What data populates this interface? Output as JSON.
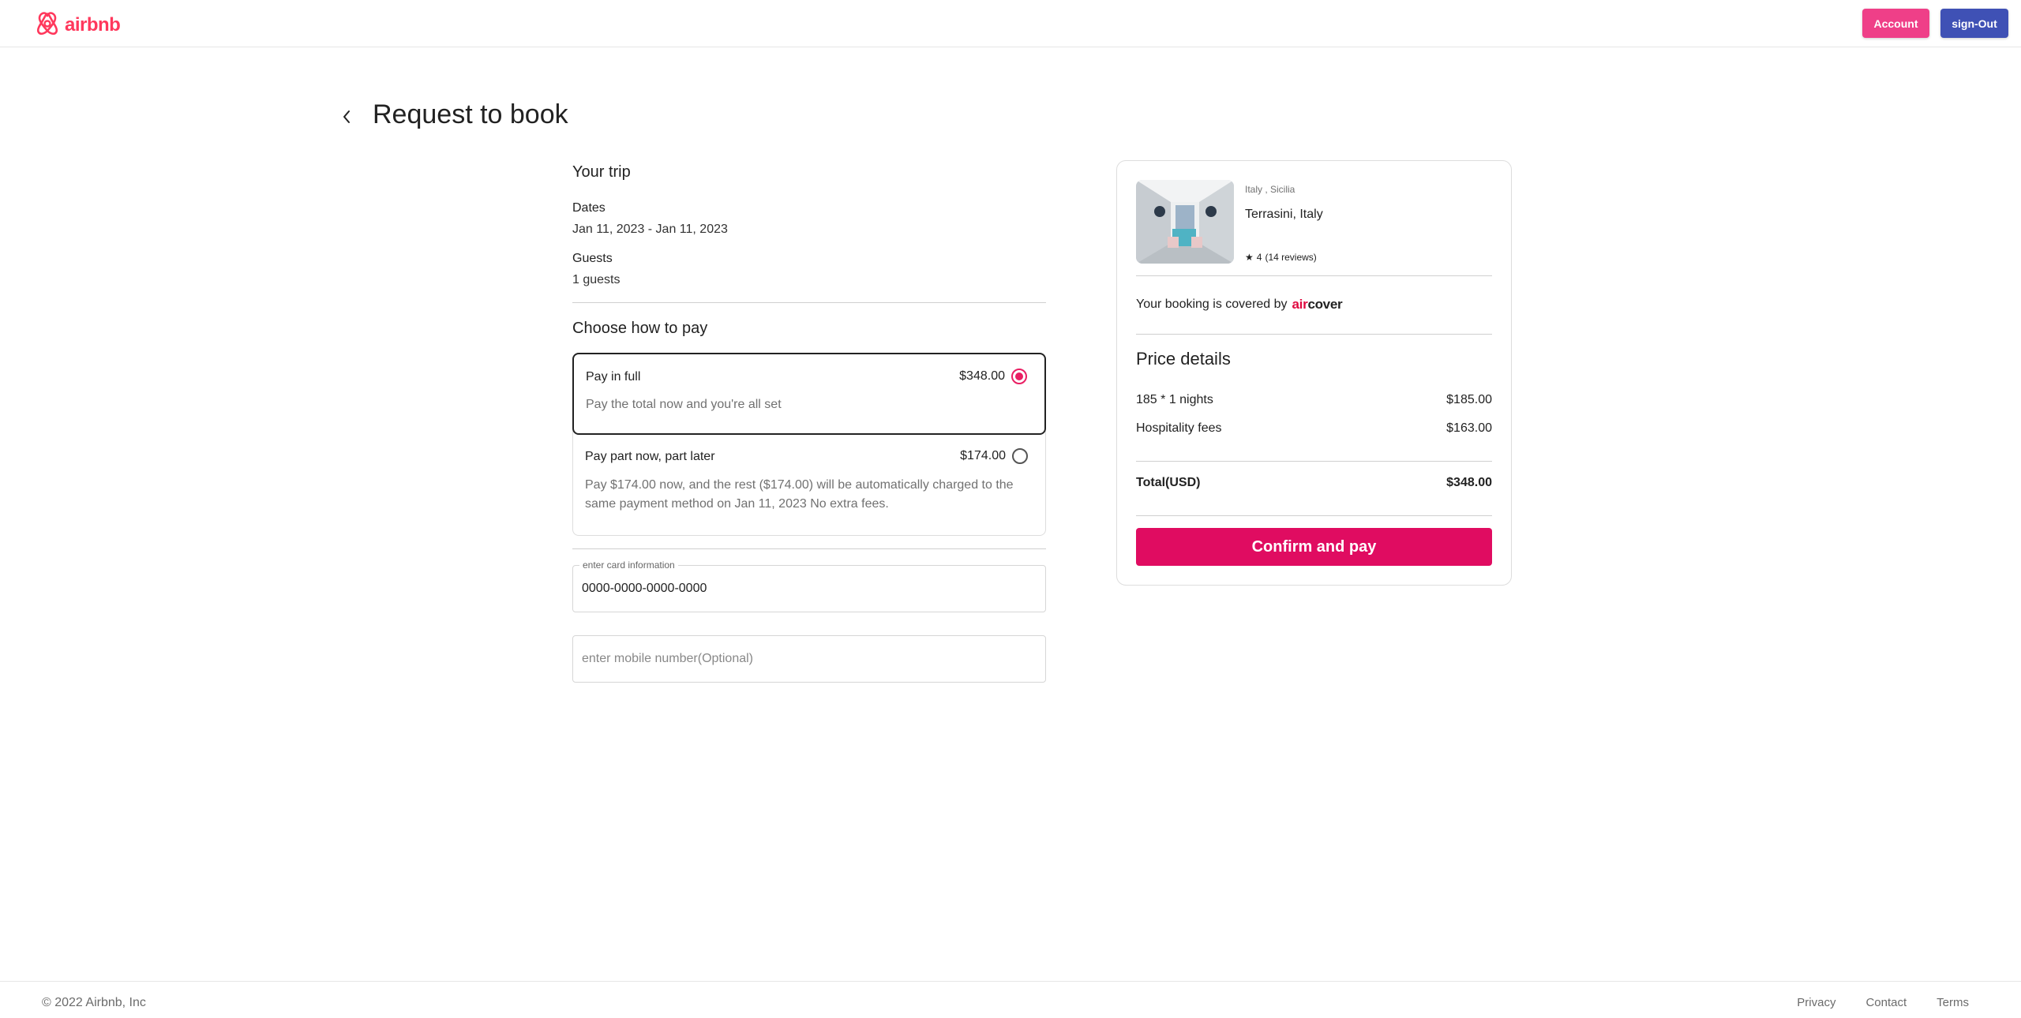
{
  "header": {
    "brand": "airbnb",
    "account_label": "Account",
    "signout_label": "sign-Out",
    "colors": {
      "brand": "#ff385c",
      "account": "#ef3f88",
      "signout": "#3f51b5"
    }
  },
  "page_title": "Request to book",
  "trip": {
    "heading": "Your trip",
    "dates_label": "Dates",
    "dates_value": "Jan 11, 2023 - Jan 11, 2023",
    "guests_label": "Guests",
    "guests_value": "1 guests"
  },
  "payment": {
    "heading": "Choose how to pay",
    "options": [
      {
        "title": "Pay in full",
        "price": "$348.00",
        "desc": "Pay the total now and you're all set",
        "selected": true
      },
      {
        "title": "Pay part now, part later",
        "price": "$174.00",
        "desc": "Pay $174.00 now, and the rest ($174.00) will be automatically charged to the same payment method on Jan 11, 2023 No extra fees.",
        "selected": false
      }
    ]
  },
  "card_field": {
    "label": "enter card information",
    "value": "0000-0000-0000-0000"
  },
  "mobile_field": {
    "placeholder": "enter mobile number(Optional)"
  },
  "listing": {
    "location_small": "Italy , Sicilia",
    "name": "Terrasini, Italy",
    "rating": "4",
    "reviews": "(14 reviews)"
  },
  "coverage": {
    "text": "Your booking is covered by",
    "brand_air": "air",
    "brand_cover": "cover"
  },
  "price_details": {
    "heading": "Price details",
    "rows": [
      {
        "label": "185 * 1 nights",
        "value": "$185.00"
      },
      {
        "label": "Hospitality fees",
        "value": "$163.00"
      }
    ],
    "total_label": "Total(USD)",
    "total_value": "$348.00",
    "confirm_label": "Confirm and pay",
    "confirm_color": "#e00c61"
  },
  "footer": {
    "copyright": "© 2022 Airbnb, Inc",
    "links": [
      "Privacy",
      "Contact",
      "Terms"
    ]
  }
}
